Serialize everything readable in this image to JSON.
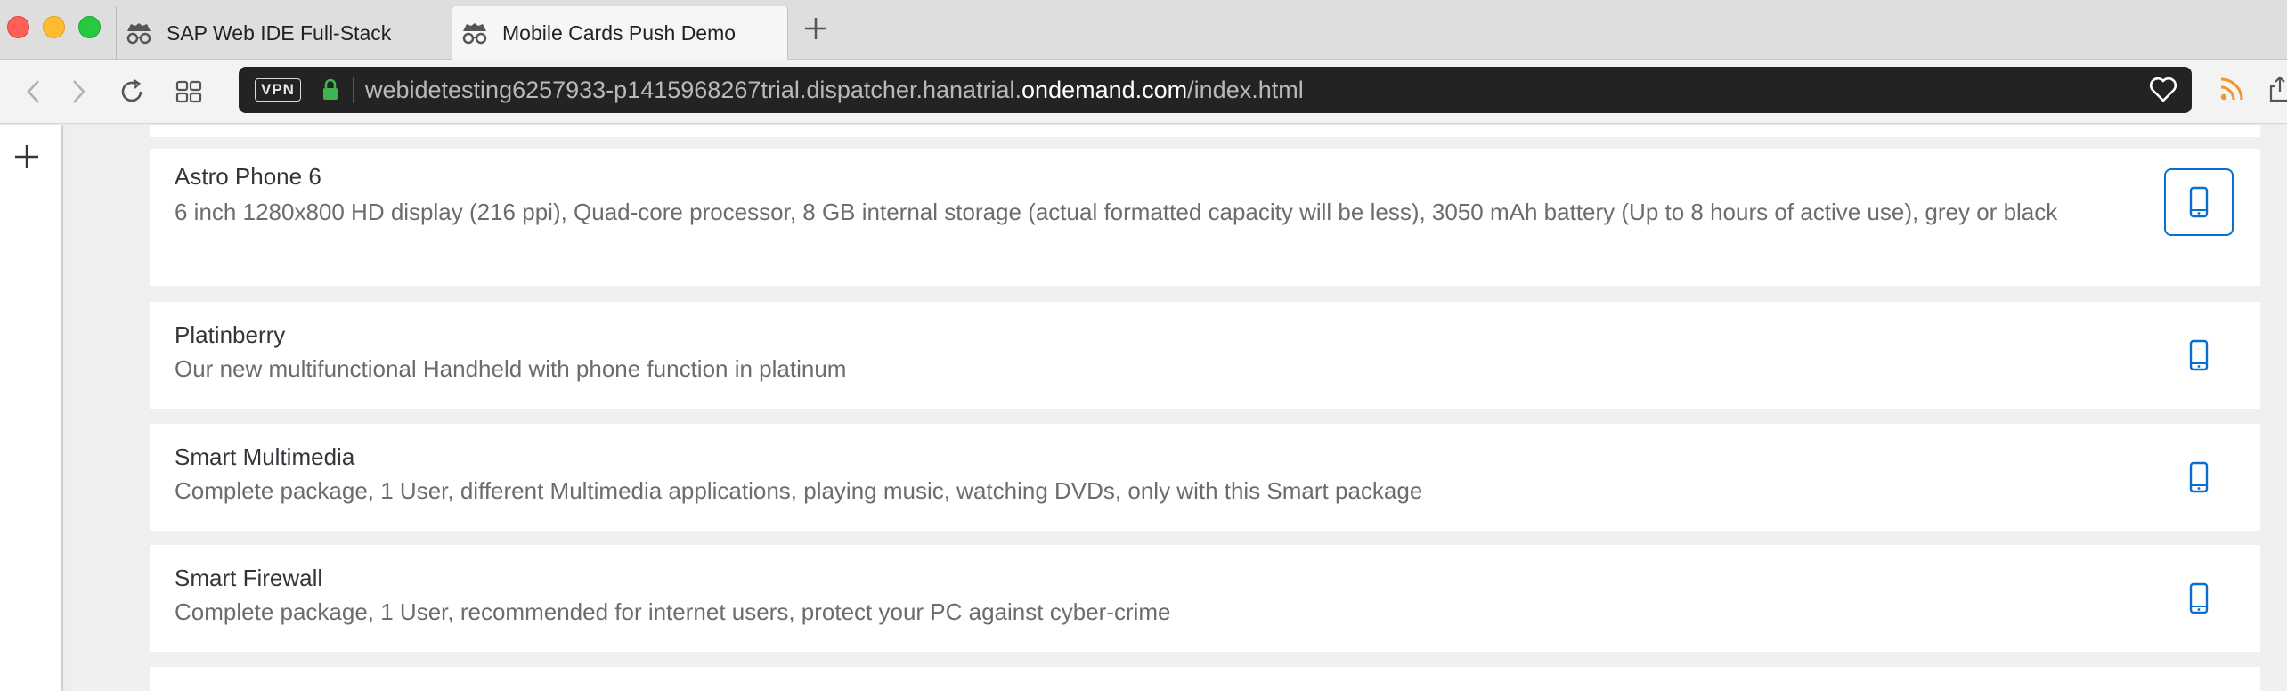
{
  "browser": {
    "tabs": [
      {
        "label": "SAP Web IDE Full-Stack",
        "icon": "incognito-icon",
        "active": false
      },
      {
        "label": "Mobile Cards Push Demo",
        "icon": "incognito-icon",
        "active": true
      }
    ],
    "vpn_label": "VPN",
    "url": {
      "prefix": "webidetesting6257933-p1415968267trial.dispatcher.hanatrial.",
      "host": "ondemand.com",
      "path": "/index.html"
    }
  },
  "products": [
    {
      "name": "Astro Phone 6",
      "description": "6 inch 1280x800 HD display (216 ppi), Quad-core processor, 8 GB internal storage (actual formatted capacity will be less), 3050 mAh battery (Up to 8 hours of active use), grey or black",
      "icon": "phone-icon"
    },
    {
      "name": "Platinberry",
      "description": "Our new multifunctional Handheld with phone function in platinum",
      "icon": "phone-icon"
    },
    {
      "name": "Smart Multimedia",
      "description": "Complete package, 1 User, different Multimedia applications, playing music, watching DVDs, only with this Smart package",
      "icon": "phone-icon"
    },
    {
      "name": "Smart Firewall",
      "description": "Complete package, 1 User, recommended for internet users, protect your PC against cyber-crime",
      "icon": "phone-icon"
    }
  ],
  "colors": {
    "accent": "#0a6ed1",
    "title_text": "#32363a",
    "description_text": "#6a6d70"
  }
}
